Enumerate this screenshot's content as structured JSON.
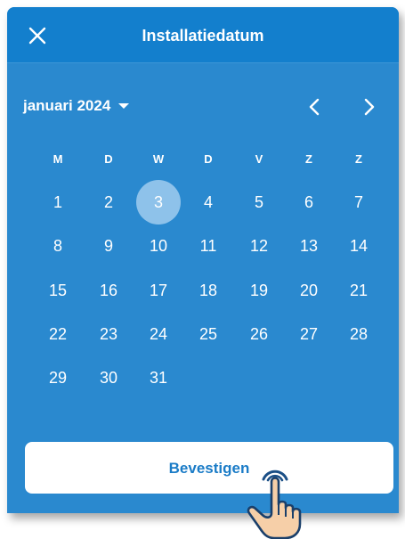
{
  "header": {
    "title": "Installatiedatum",
    "close_icon": "close-icon"
  },
  "calendar": {
    "month_label": "januari 2024",
    "prev_icon": "chevron-left-icon",
    "next_icon": "chevron-right-icon",
    "weekdays": [
      "M",
      "D",
      "W",
      "D",
      "V",
      "Z",
      "Z"
    ],
    "days": [
      "1",
      "2",
      "3",
      "4",
      "5",
      "6",
      "7",
      "8",
      "9",
      "10",
      "11",
      "12",
      "13",
      "14",
      "15",
      "16",
      "17",
      "18",
      "19",
      "20",
      "21",
      "22",
      "23",
      "24",
      "25",
      "26",
      "27",
      "28",
      "29",
      "30",
      "31"
    ],
    "selected_day": "3"
  },
  "footer": {
    "confirm_label": "Bevestigen",
    "pointer_icon": "hand-pointer-icon"
  },
  "colors": {
    "panel_bg": "#2a89cf",
    "header_bg": "#137fcd",
    "selected_day_bg": "#8ec2ea",
    "button_text": "#1b7cc7"
  }
}
